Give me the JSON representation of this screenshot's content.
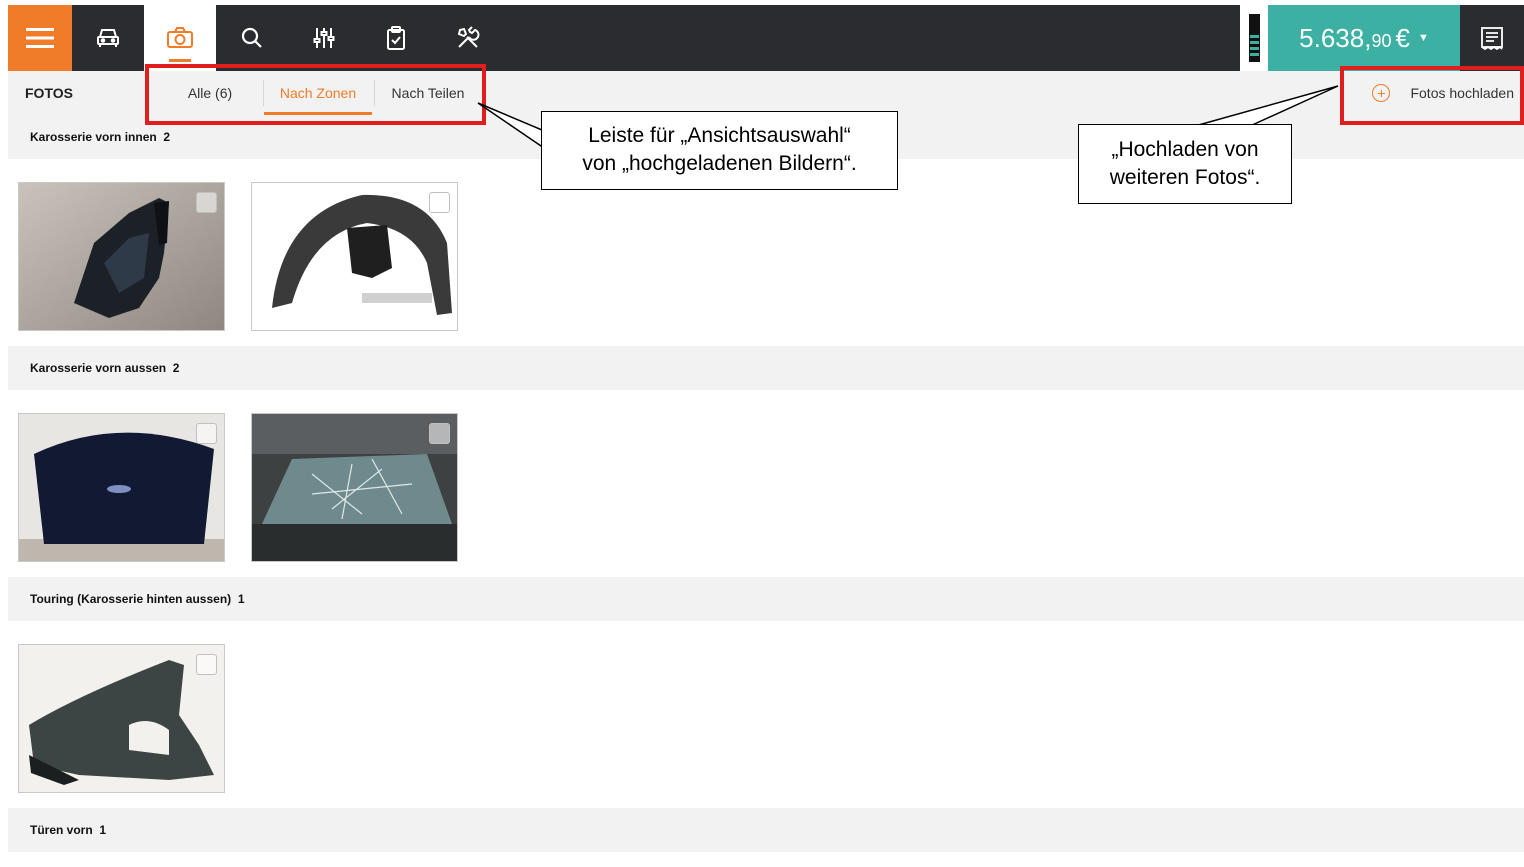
{
  "toolbar": {
    "icons": [
      "menu-icon",
      "car-icon",
      "camera-icon",
      "search-icon",
      "sliders-icon",
      "clipboard-icon",
      "tools-icon"
    ],
    "price_main": "5.638,",
    "price_cents": "90",
    "price_currency": "€",
    "receipt_icon": "receipt-icon"
  },
  "subbar": {
    "title": "FOTOS",
    "tabs": [
      {
        "label": "Alle (6)"
      },
      {
        "label": "Nach Zonen"
      },
      {
        "label": "Nach Teilen"
      }
    ],
    "upload_label": "Fotos hochladen"
  },
  "sections": [
    {
      "name": "Karosserie vorn innen",
      "count": "2"
    },
    {
      "name": "Karosserie vorn aussen",
      "count": "2"
    },
    {
      "name": "Touring (Karosserie hinten aussen)",
      "count": "1"
    },
    {
      "name": "Türen vorn",
      "count": "1"
    }
  ],
  "callouts": {
    "view_bar": [
      "Leiste für „Ansichtsauswahl“",
      "von „hochgeladenen Bildern“."
    ],
    "upload": [
      "„Hochladen von",
      "weiteren Fotos“."
    ]
  },
  "colors": {
    "accent": "#f07c2a",
    "topbar": "#2b2c30",
    "teal": "#3bb0a3",
    "highlight": "#e01e1e"
  }
}
